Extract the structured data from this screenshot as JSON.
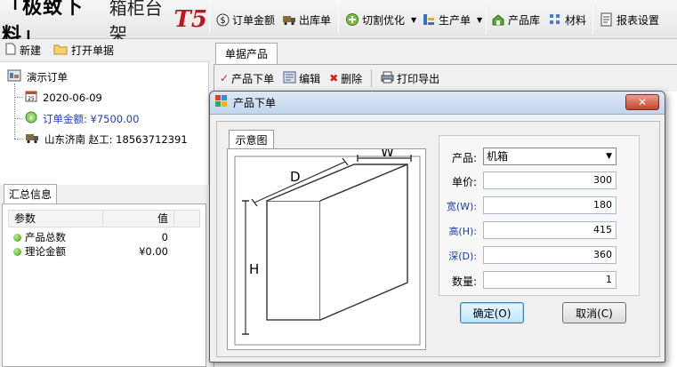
{
  "app": {
    "logo_main": "「极致下料」",
    "logo_sub": "箱柜台架",
    "logo_version": "T5"
  },
  "toolbar": {
    "items": [
      {
        "label": "订单金额",
        "icon": "dollar-icon"
      },
      {
        "label": "出库单",
        "icon": "truck-icon"
      },
      {
        "label": "切割优化",
        "icon": "cutting-icon"
      },
      {
        "label": "生产单",
        "icon": "production-icon"
      },
      {
        "label": "产品库",
        "icon": "product-library-icon"
      },
      {
        "label": "材料",
        "icon": "material-icon"
      },
      {
        "label": "报表设置",
        "icon": "report-icon"
      }
    ]
  },
  "left": {
    "new_label": "新建",
    "open_label": "打开单据",
    "tree": {
      "root": "演示订单",
      "date": "2020-06-09",
      "amount": "订单金额: ¥7500.00",
      "customer": "山东济南 赵工: 18563712391"
    },
    "summary": {
      "tab": "汇总信息",
      "col_param": "参数",
      "col_value": "值",
      "rows": [
        {
          "name": "产品总数",
          "value": "0"
        },
        {
          "name": "理论金额",
          "value": "¥0.00"
        }
      ]
    }
  },
  "right": {
    "tab": "单据产品",
    "tools": {
      "order_label": "产品下单",
      "edit_label": "编辑",
      "delete_label": "删除",
      "print_label": "打印导出"
    }
  },
  "dialog": {
    "title": "产品下单",
    "close": "✕",
    "diagram_tab": "示意图",
    "diagram": {
      "d": "D",
      "w": "W",
      "h": "H"
    },
    "fields": {
      "product_label": "产品:",
      "product_value": "机箱",
      "price_label": "单价:",
      "price_value": "300",
      "width_label": "宽(W):",
      "width_value": "180",
      "height_label": "高(H):",
      "height_value": "415",
      "depth_label": "深(D):",
      "depth_value": "360",
      "qty_label": "数量:",
      "qty_value": "1"
    },
    "ok_label": "确定(O)",
    "cancel_label": "取消(C)"
  },
  "colors": {
    "logo_version": "#c0141b",
    "dim_label_blue": "#1a3aa8",
    "amount_blue": "#1f3cc0"
  }
}
